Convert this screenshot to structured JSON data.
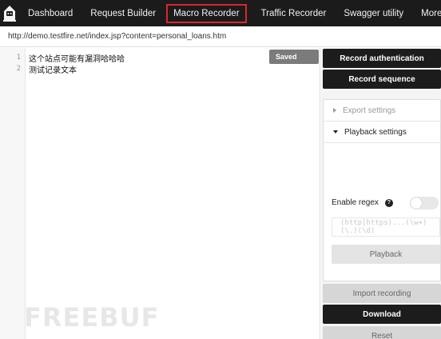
{
  "nav": {
    "items": [
      "Dashboard",
      "Request Builder",
      "Macro Recorder",
      "Traffic Recorder",
      "Swagger utility"
    ],
    "more_label": "More",
    "active": "Macro Recorder",
    "logo_icon": "hooded-figure-logo-icon"
  },
  "url": "http://demo.testfire.net/index.jsp?content=personal_loans.htm",
  "editor": {
    "lines": [
      {
        "no": "1",
        "text": "这个站点可能有漏洞哈哈哈"
      },
      {
        "no": "2",
        "text": "测试记录文本"
      }
    ],
    "saved_label": "Saved"
  },
  "side": {
    "record_auth": "Record authentication",
    "record_sequence": "Record sequence",
    "export_settings": "Export settings",
    "playback_settings": "Playback settings",
    "enable_regex": "Enable regex",
    "help_glyph": "?",
    "regex_placeholder": "(http|https)...(\\w+)(\\.)(\\d)",
    "playback": "Playback",
    "import_recording": "Import recording",
    "download": "Download",
    "reset": "Reset"
  },
  "watermark": "FREEBUF",
  "colors": {
    "nav_bg": "#1b1b1b",
    "active_border": "#d9272e",
    "dark_button": "#1c1c1c",
    "saved_badge": "#7b7b7b"
  }
}
